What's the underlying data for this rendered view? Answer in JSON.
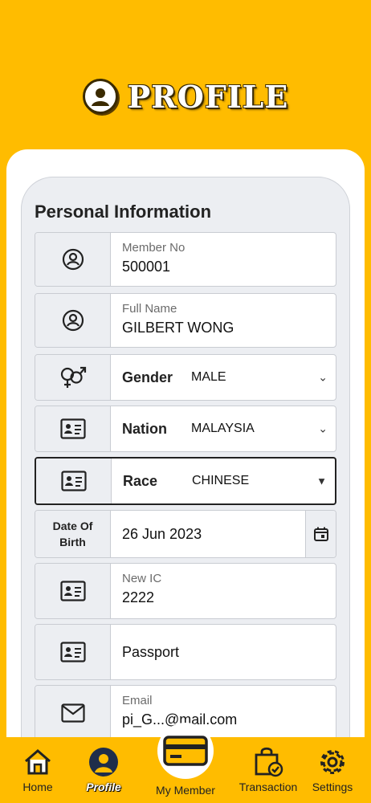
{
  "header": {
    "title": "PROFILE",
    "icon": "user-circle-icon"
  },
  "section": {
    "title": "Personal Information"
  },
  "fields": {
    "member_no": {
      "label": "Member No",
      "value": "500001"
    },
    "full_name": {
      "label": "Full Name",
      "value": "GILBERT WONG"
    },
    "gender": {
      "label": "Gender",
      "value": "MALE"
    },
    "nation": {
      "label": "Nation",
      "value": "MALAYSIA"
    },
    "race": {
      "label": "Race",
      "value": "CHINESE"
    },
    "dob": {
      "label": "Date Of Birth",
      "value": "26 Jun 2023"
    },
    "new_ic": {
      "label": "New IC",
      "value": "2222"
    },
    "passport": {
      "placeholder": "Passport"
    },
    "email": {
      "label": "Email",
      "value": "pi_G...@mail.com"
    }
  },
  "nav": {
    "home": "Home",
    "profile": "Profile",
    "member": "My Member",
    "transaction": "Transaction",
    "settings": "Settings"
  },
  "colors": {
    "brand": "#FFBC00",
    "card_bg": "#ECEEF2"
  }
}
